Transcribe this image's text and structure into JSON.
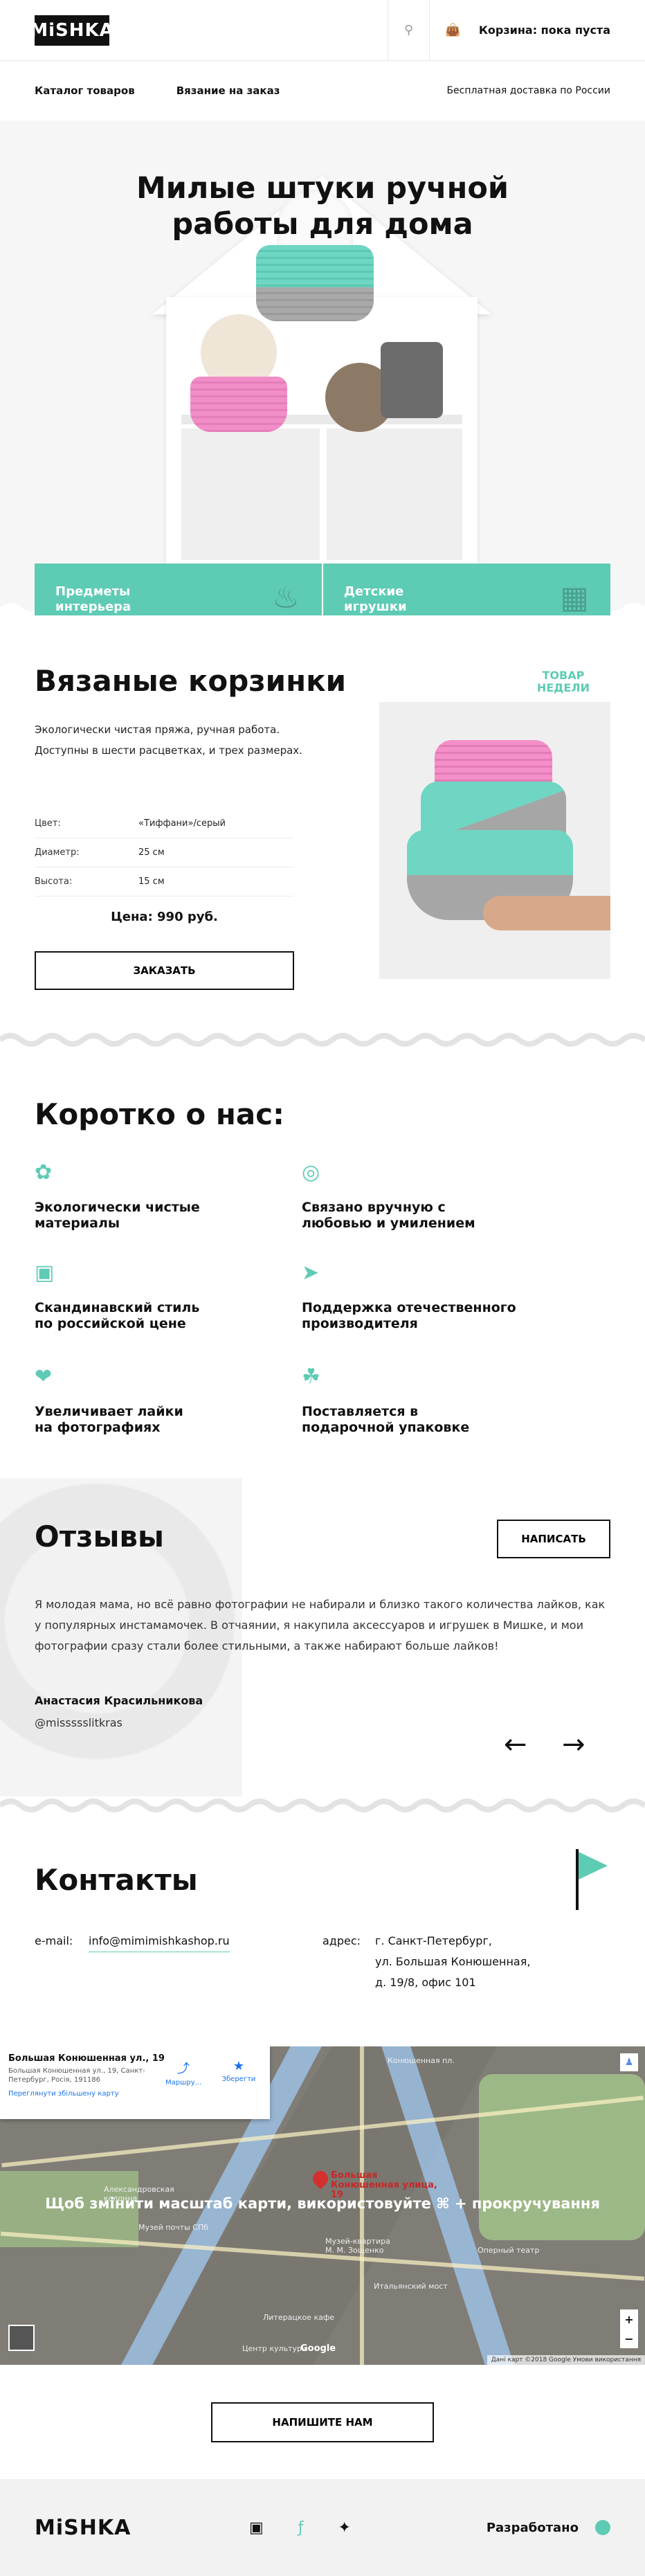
{
  "header": {
    "logo": "MiSHKA",
    "cart_label": "Корзина: пока пуста",
    "search_icon": "search-icon",
    "cart_icon": "bag-icon"
  },
  "nav": {
    "catalog": "Каталог товаров",
    "custom": "Вязание на заказ",
    "shipping": "Бесплатная доставка по России"
  },
  "hero": {
    "title_line1": "Милые штуки ручной",
    "title_line2": "работы для дома",
    "categories": [
      {
        "label_line1": "Предметы",
        "label_line2": "интерьера",
        "icon": "lamp-icon"
      },
      {
        "label_line1": "Детские",
        "label_line2": "игрушки",
        "icon": "blocks-icon"
      }
    ]
  },
  "product": {
    "title": "Вязаные корзинки",
    "badge_line1": "ТОВАР",
    "badge_line2": "НЕДЕЛИ",
    "description": "Экологически чистая пряжа, ручная работа. Доступны в шести расцветках, и трех размерах.",
    "specs": [
      {
        "key": "Цвет:",
        "value": "«Тиффани»/серый"
      },
      {
        "key": "Диаметр:",
        "value": "25 см"
      },
      {
        "key": "Высота:",
        "value": "15 см"
      }
    ],
    "price": "Цена: 990 руб.",
    "order_button": "ЗАКАЗАТЬ"
  },
  "about": {
    "title": "Коротко о нас:",
    "features": [
      {
        "line1": "Экологически чистые",
        "line2": "материалы",
        "icon": "flower-icon"
      },
      {
        "line1": "Связано вручную с",
        "line2": "любовью и умилением",
        "icon": "yarn-icon"
      },
      {
        "line1": "Скандинавский стиль",
        "line2": "по российской цене",
        "icon": "banknote-icon"
      },
      {
        "line1": "Поддержка отечественного",
        "line2": "производителя",
        "icon": "rocket-icon"
      },
      {
        "line1": "Увеличивает лайки",
        "line2": "на фотографиях",
        "icon": "heart-icon"
      },
      {
        "line1": "Поставляется в",
        "line2": "подарочной упаковке",
        "icon": "gift-icon"
      }
    ]
  },
  "reviews": {
    "title": "Отзывы",
    "write_button": "НАПИСАТЬ",
    "text": "Я молодая мама, но всё равно фотографии не набирали и близко такого количества лайков, как у популярных инстамамочек. В отчаянии, я накупила аксессуаров и игрушек в Мишке, и мои фотографии сразу стали более стильными, а также набирают больше лайков!",
    "author": "Анастасия Красильникова",
    "handle": "@missssslitkras",
    "prev": "←",
    "next": "→"
  },
  "contacts": {
    "title": "Контакты",
    "email_label": "e-mail:",
    "email": "info@mimimishkashop.ru",
    "address_label": "адрес:",
    "address_line1": "г. Санкт-Петербург,",
    "address_line2": "ул. Большая Конюшенная,",
    "address_line3": "д. 19/8, офис 101"
  },
  "map": {
    "card_title": "Большая Конюшенная ул., 19",
    "card_address": "Большая Конюшенная ул., 19, Санкт-Петербург, Росія, 191186",
    "card_link": "Переглянути збільшену карту",
    "route_label": "Маршру...",
    "save_label": "Зберегти",
    "pin_label": "Большая Конюшенная улица, 19",
    "hint": "Щоб змінити масштаб карти, використовуйте ⌘ + прокручування",
    "google": "Google",
    "footer": "Дані карт ©2018 Google   Умови використання",
    "zoom_in": "+",
    "zoom_out": "−",
    "labels": [
      "Конюшенная пл.",
      "Александровская колонна",
      "Музей почты СПб",
      "Музей-квартира М. М. Зощенко",
      "Оперный театр",
      "Итальянский мост",
      "Литерацкое кафе",
      "Центр культуры"
    ]
  },
  "write_us": "НАПИШИТЕ НАМ",
  "footer": {
    "logo": "MiSHKA",
    "developer": "Разработано",
    "social_icons": [
      "instagram-icon",
      "facebook-icon",
      "twitter-icon"
    ]
  },
  "colors": {
    "accent": "#5ecbb4",
    "text": "#111111",
    "bg_light": "#f6f6f6"
  }
}
